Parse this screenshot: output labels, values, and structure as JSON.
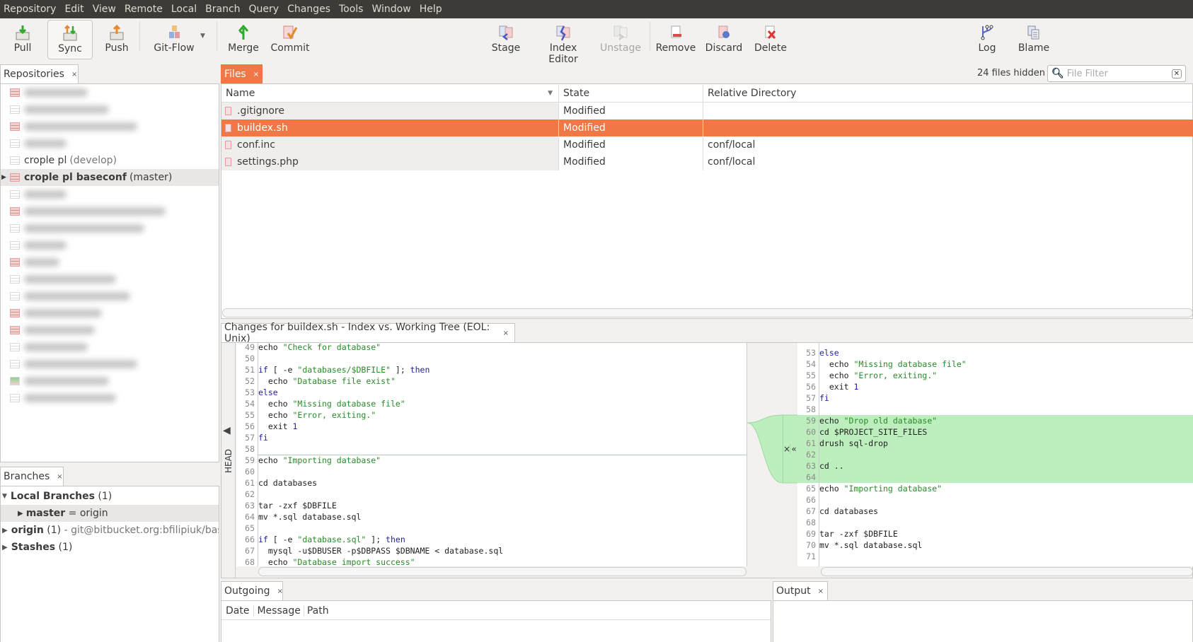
{
  "menu": [
    "Repository",
    "Edit",
    "View",
    "Remote",
    "Local",
    "Branch",
    "Query",
    "Changes",
    "Tools",
    "Window",
    "Help"
  ],
  "toolbar": {
    "pull": "Pull",
    "sync": "Sync",
    "push": "Push",
    "gitflow": "Git-Flow",
    "merge": "Merge",
    "commit": "Commit",
    "stage": "Stage",
    "index_editor": "Index Editor",
    "unstage": "Unstage",
    "remove": "Remove",
    "discard": "Discard",
    "delete": "Delete",
    "log": "Log",
    "blame": "Blame"
  },
  "repositories": {
    "tab": "Repositories",
    "visible_items": [
      {
        "name": "crople pl",
        "branch": "(develop)"
      },
      {
        "name": "crople pl baseconf",
        "branch": "(master)"
      }
    ]
  },
  "branches": {
    "tab": "Branches",
    "local": {
      "label": "Local Branches",
      "count": "(1)"
    },
    "master": {
      "name": "master",
      "eq": "=",
      "tracking": "origin"
    },
    "origin": {
      "label": "origin",
      "count": "(1)",
      "url": "- git@bitbucket.org:bfilipiuk/basec"
    },
    "stashes": {
      "label": "Stashes",
      "count": "(1)"
    }
  },
  "files": {
    "tab": "Files",
    "hidden": "24 files hidden",
    "filter_placeholder": "File Filter",
    "columns": [
      "Name",
      "State",
      "Relative Directory"
    ],
    "rows": [
      {
        "name": ".gitignore",
        "state": "Modified",
        "dir": ""
      },
      {
        "name": "buildex.sh",
        "state": "Modified",
        "dir": "",
        "selected": true
      },
      {
        "name": "conf.inc",
        "state": "Modified",
        "dir": "conf/local"
      },
      {
        "name": "settings.php",
        "state": "Modified",
        "dir": "conf/local"
      }
    ],
    "selection_color": "#f07746"
  },
  "diff": {
    "tab": "Changes for buildex.sh - Index vs. Working Tree (EOL: Unix)",
    "head_label": "HEAD",
    "added_color": "#bdeebd",
    "left": [
      {
        "n": "49",
        "t": [
          [
            "echo ",
            "pl"
          ],
          [
            "\"Check for database\"",
            "str"
          ]
        ]
      },
      {
        "n": "50",
        "t": []
      },
      {
        "n": "51",
        "t": [
          [
            "if",
            "kw"
          ],
          [
            " [ -e ",
            "pl"
          ],
          [
            "\"databases/$DBFILE\"",
            "str"
          ],
          [
            " ]; ",
            "pl"
          ],
          [
            "then",
            "kw"
          ]
        ]
      },
      {
        "n": "52",
        "t": [
          [
            "  echo ",
            "pl"
          ],
          [
            "\"Database file exist\"",
            "str"
          ]
        ]
      },
      {
        "n": "53",
        "t": [
          [
            "else",
            "kw"
          ]
        ]
      },
      {
        "n": "54",
        "t": [
          [
            "  echo ",
            "pl"
          ],
          [
            "\"Missing database file\"",
            "str"
          ]
        ]
      },
      {
        "n": "55",
        "t": [
          [
            "  echo ",
            "pl"
          ],
          [
            "\"Error, exiting.\"",
            "str"
          ]
        ]
      },
      {
        "n": "56",
        "t": [
          [
            "  exit ",
            "pl"
          ],
          [
            "1",
            "num"
          ]
        ]
      },
      {
        "n": "57",
        "t": [
          [
            "fi",
            "kw"
          ]
        ]
      },
      {
        "n": "58",
        "t": []
      },
      {
        "n": "59",
        "t": [
          [
            "echo ",
            "pl"
          ],
          [
            "\"Importing database\"",
            "str"
          ]
        ]
      },
      {
        "n": "60",
        "t": []
      },
      {
        "n": "61",
        "t": [
          [
            "cd databases",
            "pl"
          ]
        ]
      },
      {
        "n": "62",
        "t": []
      },
      {
        "n": "63",
        "t": [
          [
            "tar -zxf $DBFILE",
            "pl"
          ]
        ]
      },
      {
        "n": "64",
        "t": [
          [
            "mv *.sql database.sql",
            "pl"
          ]
        ]
      },
      {
        "n": "65",
        "t": []
      },
      {
        "n": "66",
        "t": [
          [
            "if",
            "kw"
          ],
          [
            " [ -e ",
            "pl"
          ],
          [
            "\"database.sql\"",
            "str"
          ],
          [
            " ]; ",
            "pl"
          ],
          [
            "then",
            "kw"
          ]
        ]
      },
      {
        "n": "67",
        "t": [
          [
            "  mysql -u$DBUSER -p$DBPASS $DBNAME < database.sql",
            "pl"
          ]
        ]
      },
      {
        "n": "68",
        "t": [
          [
            "  echo ",
            "pl"
          ],
          [
            "\"Database import success\"",
            "str"
          ]
        ]
      }
    ],
    "right": [
      {
        "n": "53",
        "t": [
          [
            "else",
            "kw"
          ]
        ]
      },
      {
        "n": "54",
        "t": [
          [
            "  echo ",
            "pl"
          ],
          [
            "\"Missing database file\"",
            "str"
          ]
        ]
      },
      {
        "n": "55",
        "t": [
          [
            "  echo ",
            "pl"
          ],
          [
            "\"Error, exiting.\"",
            "str"
          ]
        ]
      },
      {
        "n": "56",
        "t": [
          [
            "  exit ",
            "pl"
          ],
          [
            "1",
            "num"
          ]
        ]
      },
      {
        "n": "57",
        "t": [
          [
            "fi",
            "kw"
          ]
        ]
      },
      {
        "n": "58",
        "t": []
      },
      {
        "n": "59",
        "t": [
          [
            "echo ",
            "pl"
          ],
          [
            "\"Drop old database\"",
            "str"
          ]
        ],
        "added": true
      },
      {
        "n": "60",
        "t": [
          [
            "cd $PROJECT_SITE_FILES",
            "pl"
          ]
        ],
        "added": true
      },
      {
        "n": "61",
        "t": [
          [
            "drush sql-drop",
            "pl"
          ]
        ],
        "added": true
      },
      {
        "n": "62",
        "t": [],
        "added": true
      },
      {
        "n": "63",
        "t": [
          [
            "cd ..",
            "pl"
          ]
        ],
        "added": true
      },
      {
        "n": "64",
        "t": [],
        "added": true
      },
      {
        "n": "65",
        "t": [
          [
            "echo ",
            "pl"
          ],
          [
            "\"Importing database\"",
            "str"
          ]
        ]
      },
      {
        "n": "66",
        "t": []
      },
      {
        "n": "67",
        "t": [
          [
            "cd databases",
            "pl"
          ]
        ]
      },
      {
        "n": "68",
        "t": []
      },
      {
        "n": "69",
        "t": [
          [
            "tar -zxf $DBFILE",
            "pl"
          ]
        ]
      },
      {
        "n": "70",
        "t": [
          [
            "mv *.sql database.sql",
            "pl"
          ]
        ]
      },
      {
        "n": "71",
        "t": []
      }
    ],
    "hunk_actions": {
      "discard": "×",
      "revert": "«"
    }
  },
  "outgoing": {
    "tab": "Outgoing",
    "columns": [
      "Date",
      "Message",
      "Path"
    ]
  },
  "output": {
    "tab": "Output"
  }
}
